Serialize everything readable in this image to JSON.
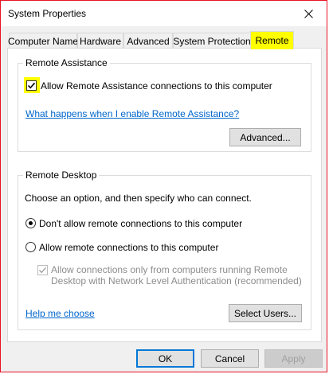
{
  "window": {
    "title": "System Properties"
  },
  "tabs": [
    {
      "label": "Computer Name",
      "active": false
    },
    {
      "label": "Hardware",
      "active": false
    },
    {
      "label": "Advanced",
      "active": false
    },
    {
      "label": "System Protection",
      "active": false
    },
    {
      "label": "Remote",
      "active": true
    }
  ],
  "remote_assistance": {
    "group_label": "Remote Assistance",
    "allow_label": "Allow Remote Assistance connections to this computer",
    "allow_checked": true,
    "help_link": "What happens when I enable Remote Assistance?",
    "advanced_button": "Advanced..."
  },
  "remote_desktop": {
    "group_label": "Remote Desktop",
    "intro": "Choose an option, and then specify who can connect.",
    "option_dont_allow": "Don't allow remote connections to this computer",
    "option_allow": "Allow remote connections to this computer",
    "selected_option": "dont_allow",
    "nla_line1": "Allow connections only from computers running Remote",
    "nla_line2": "Desktop with Network Level Authentication (recommended)",
    "nla_checked": true,
    "help_link": "Help me choose",
    "select_users_button": "Select Users..."
  },
  "footer": {
    "ok": "OK",
    "cancel": "Cancel",
    "apply": "Apply"
  },
  "colors": {
    "highlight": "#ffff00",
    "link": "#0066cc",
    "window_border": "#e81123",
    "default_button_border": "#0078d7"
  }
}
